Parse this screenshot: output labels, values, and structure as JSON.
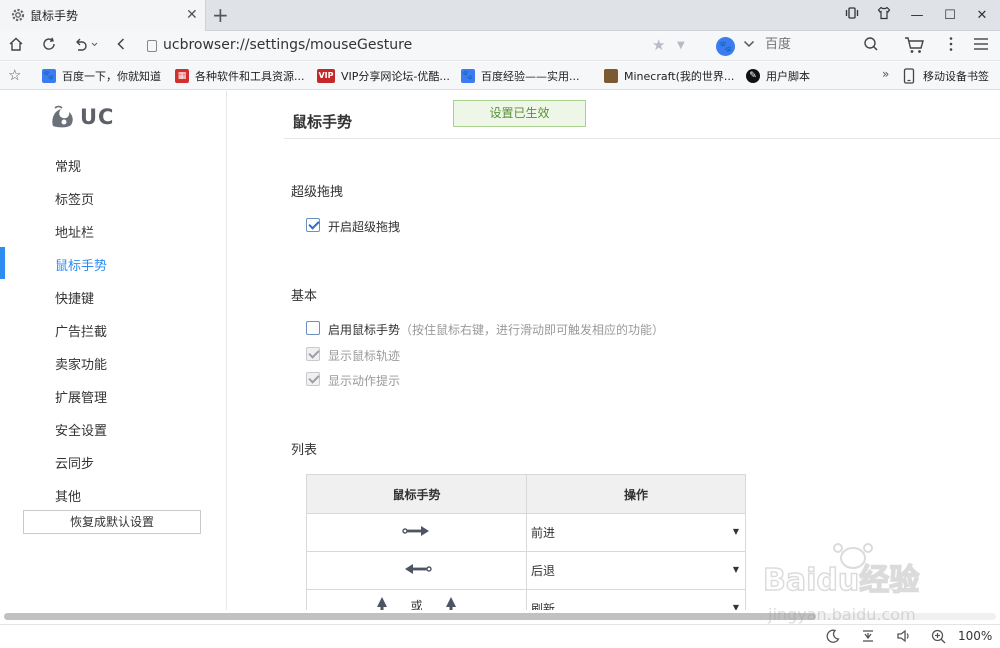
{
  "tab": {
    "title": "鼠标手势",
    "close": "✕",
    "new_tab": "+"
  },
  "window": {
    "minimize": "—",
    "maximize": "☐",
    "close": "✕"
  },
  "nav": {
    "url": "ucbrowser://settings/mouseGesture",
    "search_engine": "百度",
    "search_placeholder": "百度"
  },
  "bookmarks": [
    {
      "label": "百度一下，你就知道",
      "icon": "baidu-paw-icon",
      "color": "#3d7cf0"
    },
    {
      "label": "各种软件和工具资源...",
      "icon": "red-badge-icon",
      "color": "#d32f2f"
    },
    {
      "label": "VIP分享网论坛-优酷...",
      "icon": "vip-icon",
      "color": "#c62828"
    },
    {
      "label": "百度经验——实用...",
      "icon": "baidu-paw-icon",
      "color": "#3d7cf0"
    },
    {
      "label": "Minecraft(我的世界...",
      "icon": "minecraft-block-icon",
      "color": "#7a5a2e"
    },
    {
      "label": "用户脚本",
      "icon": "userscript-icon",
      "color": "#111111"
    }
  ],
  "bookmarks_more": "»",
  "mobile_bookmarks": "移动设备书签",
  "sidebar": {
    "logo_text": "UC",
    "items": [
      "常规",
      "标签页",
      "地址栏",
      "鼠标手势",
      "快捷键",
      "广告拦截",
      "卖家功能",
      "扩展管理",
      "安全设置",
      "云同步",
      "其他"
    ],
    "active_index": 3,
    "reset_button": "恢复成默认设置"
  },
  "main": {
    "title": "鼠标手势",
    "toast": "设置已生效",
    "super_drag": {
      "title": "超级拖拽",
      "option": {
        "label": "开启超级拖拽",
        "checked": true
      }
    },
    "basic": {
      "title": "基本",
      "enable": {
        "label": "启用鼠标手势",
        "hint": "（按住鼠标右键，进行滑动即可触发相应的功能）",
        "checked": false
      },
      "show_trail": {
        "label": "显示鼠标轨迹",
        "checked": true
      },
      "show_hint": {
        "label": "显示动作提示",
        "checked": true
      }
    },
    "list": {
      "title": "列表",
      "headers": [
        "鼠标手势",
        "操作"
      ],
      "rows": [
        {
          "gesture": "right-arrow-icon",
          "action": "前进"
        },
        {
          "gesture": "left-arrow-icon",
          "action": "后退"
        },
        {
          "gesture": "up-arrows-icon",
          "or_text": "或",
          "action": "刷新"
        }
      ]
    }
  },
  "status": {
    "zoom": "100%"
  },
  "colors": {
    "accent": "#2d8cf0",
    "toast_bg": "#eef7e7",
    "toast_border": "#a9d28f"
  }
}
